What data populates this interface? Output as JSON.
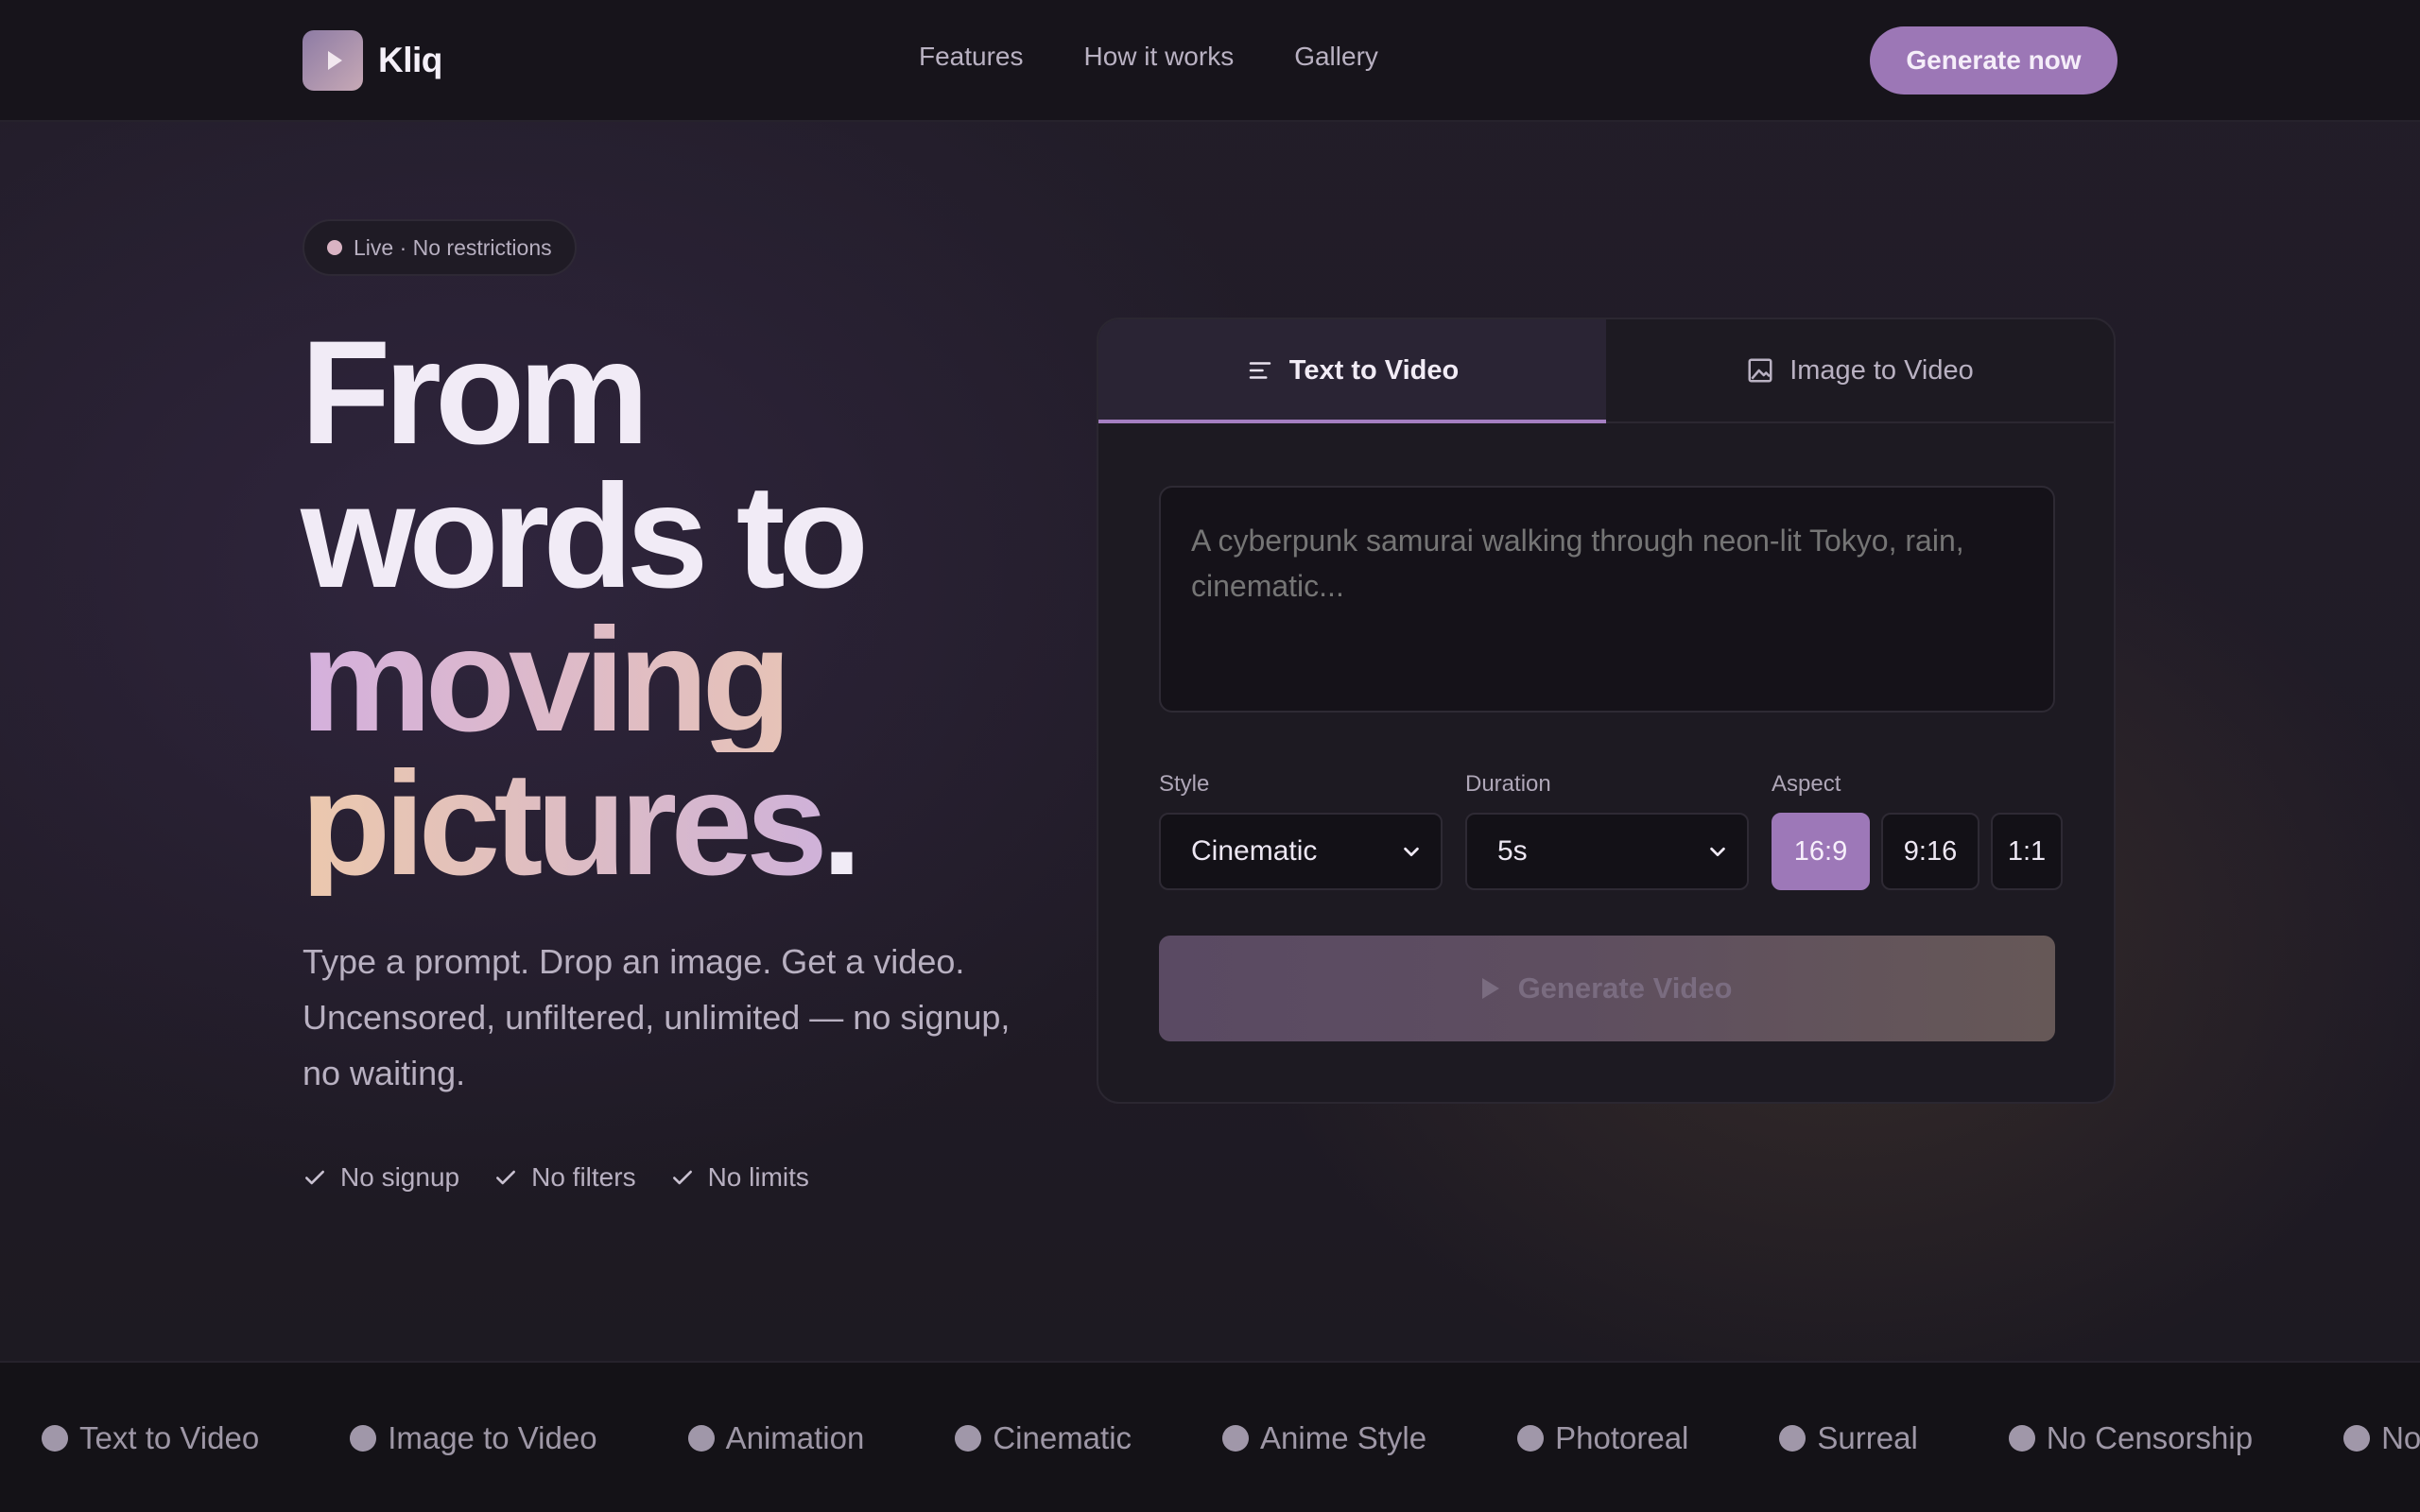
{
  "brand": {
    "name": "Kliq"
  },
  "nav": {
    "links": [
      "Features",
      "How it works",
      "Gallery"
    ],
    "cta": "Generate now"
  },
  "hero": {
    "pill": "Live · No restrictions",
    "headline": {
      "line1": "From",
      "line2": "words to",
      "line3": "moving",
      "line4": "pictures",
      "dot": "."
    },
    "subtitle": "Type a prompt. Drop an image. Get a video. Uncensored, unfiltered, unlimited — no signup, no waiting.",
    "checks": [
      "No signup",
      "No filters",
      "No limits"
    ]
  },
  "generator": {
    "tabs": [
      {
        "label": "Text to Video",
        "icon": "text-lines-icon",
        "active": true
      },
      {
        "label": "Image to Video",
        "icon": "image-icon",
        "active": false
      }
    ],
    "prompt_placeholder": "A cyberpunk samurai walking through neon-lit Tokyo, rain, cinematic...",
    "style": {
      "label": "Style",
      "value": "Cinematic"
    },
    "duration": {
      "label": "Duration",
      "value": "5s"
    },
    "aspect": {
      "label": "Aspect",
      "options": [
        "16:9",
        "9:16",
        "1:1"
      ],
      "selected": "16:9"
    },
    "submit": "Generate Video"
  },
  "marquee": [
    "Text to Video",
    "Image to Video",
    "Animation",
    "Cinematic",
    "Anime Style",
    "Photoreal",
    "Surreal",
    "No Censorship",
    "No"
  ],
  "colors": {
    "accent": "#9c77b6",
    "background": "#1c1920",
    "nav": "#17141b"
  }
}
